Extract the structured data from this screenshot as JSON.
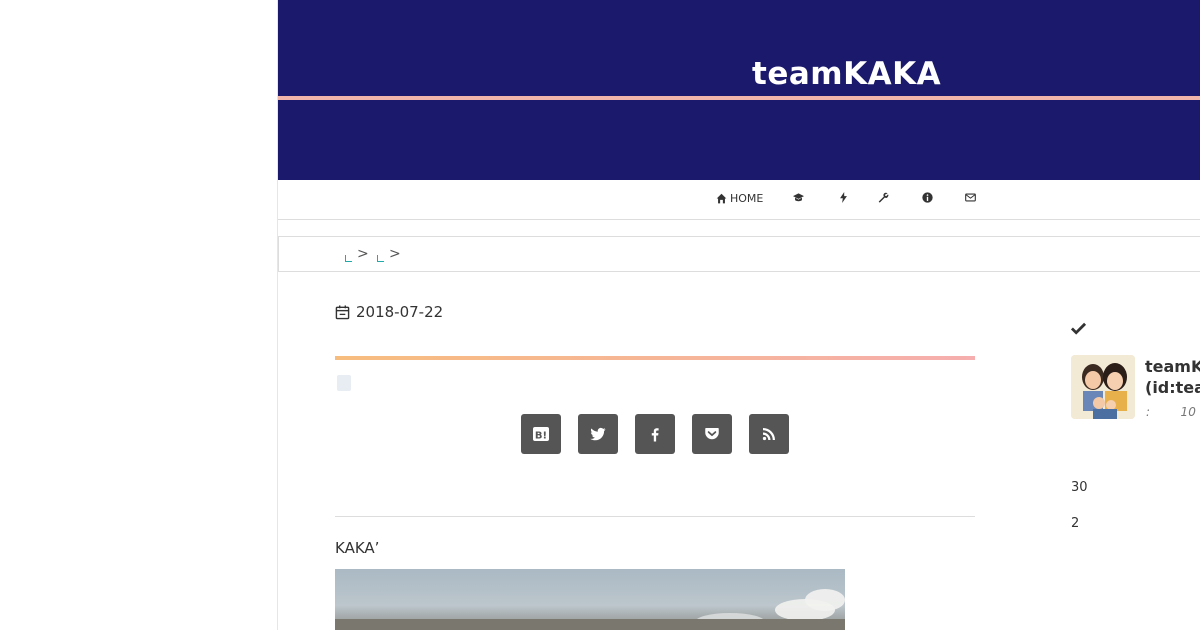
{
  "header": {
    "site_title": "teamKAKA",
    "background_color": "#1b196b",
    "accent_line_color": "#f1b6a9"
  },
  "nav": {
    "items": [
      {
        "icon": "home-icon",
        "label": "HOME"
      },
      {
        "icon": "graduation-cap-icon",
        "label": ""
      },
      {
        "icon": "bolt-icon",
        "label": ""
      },
      {
        "icon": "wrench-icon",
        "label": ""
      },
      {
        "icon": "info-icon",
        "label": ""
      },
      {
        "icon": "envelope-icon",
        "label": ""
      }
    ]
  },
  "breadcrumb": {
    "separator": ">"
  },
  "article": {
    "date": "2018-07-22",
    "intro": "KAKA’",
    "share_buttons": [
      {
        "icon": "hatena-bookmark-icon",
        "label": "B!"
      },
      {
        "icon": "twitter-icon"
      },
      {
        "icon": "facebook-icon"
      },
      {
        "icon": "pocket-icon"
      },
      {
        "icon": "rss-icon"
      }
    ],
    "share_button_color": "#555555"
  },
  "sidebar": {
    "profile_name_line1": "teamK",
    "profile_name_line2": "(id:tea",
    "profile_meta": ":        10",
    "stat_1": "30",
    "stat_2": "2"
  }
}
